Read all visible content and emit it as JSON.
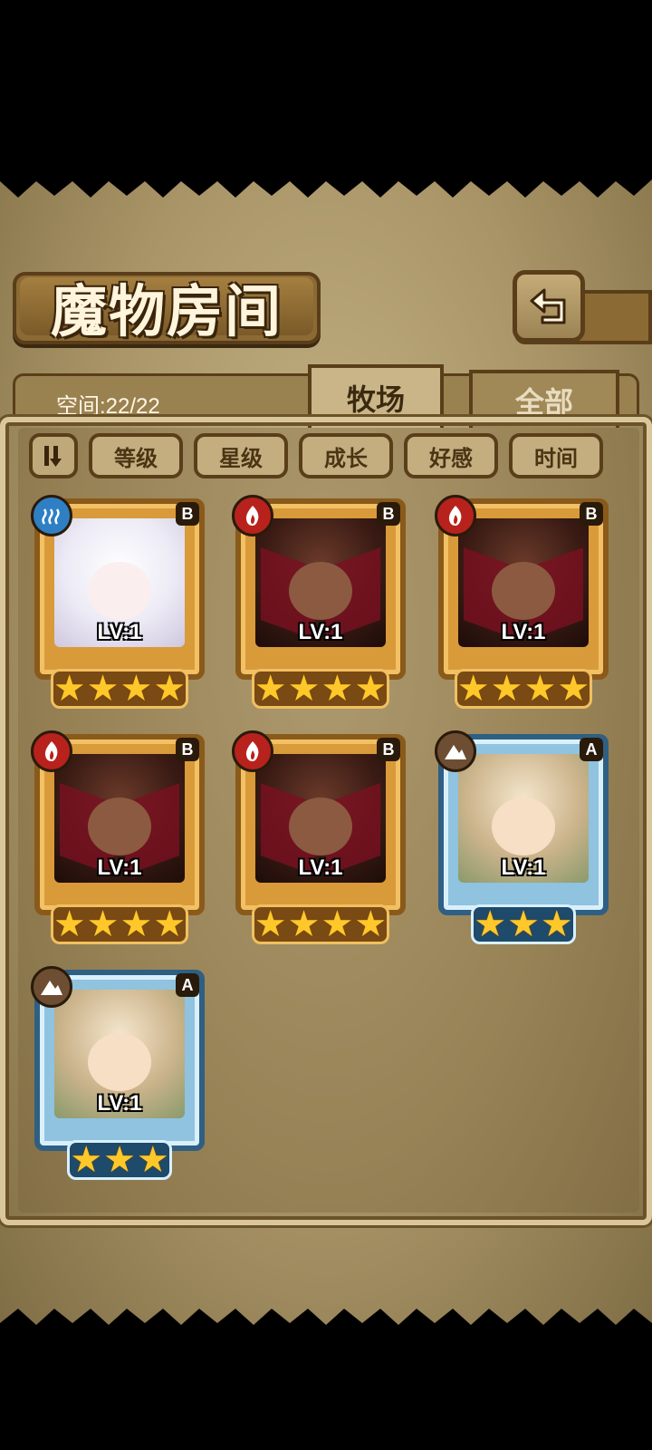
{
  "title": "魔物房间",
  "space": "空间:22/22",
  "tabs": [
    {
      "label": "牧场",
      "active": true
    },
    {
      "label": "全部",
      "active": false
    }
  ],
  "sort_buttons": [
    "等级",
    "星级",
    "成长",
    "好感",
    "时间"
  ],
  "icons": {
    "back": "back-arrow-icon",
    "sort": "sort-order-icon"
  },
  "monsters": [
    {
      "element": "water",
      "rank": "B",
      "level": "LV:1",
      "stars": 4,
      "frame": "gold"
    },
    {
      "element": "fire",
      "rank": "B",
      "level": "LV:1",
      "stars": 4,
      "frame": "gold"
    },
    {
      "element": "fire",
      "rank": "B",
      "level": "LV:1",
      "stars": 4,
      "frame": "gold"
    },
    {
      "element": "fire",
      "rank": "B",
      "level": "LV:1",
      "stars": 4,
      "frame": "gold"
    },
    {
      "element": "fire",
      "rank": "B",
      "level": "LV:1",
      "stars": 4,
      "frame": "gold"
    },
    {
      "element": "earth",
      "rank": "A",
      "level": "LV:1",
      "stars": 3,
      "frame": "blue"
    },
    {
      "element": "earth",
      "rank": "A",
      "level": "LV:1",
      "stars": 3,
      "frame": "blue"
    }
  ],
  "colors": {
    "gold_frame": "#d99a3a",
    "blue_frame": "#8fc3e0",
    "water": "#2f7fc4",
    "fire": "#b8221c",
    "earth": "#6e4e32",
    "star": "#ffc82a"
  }
}
